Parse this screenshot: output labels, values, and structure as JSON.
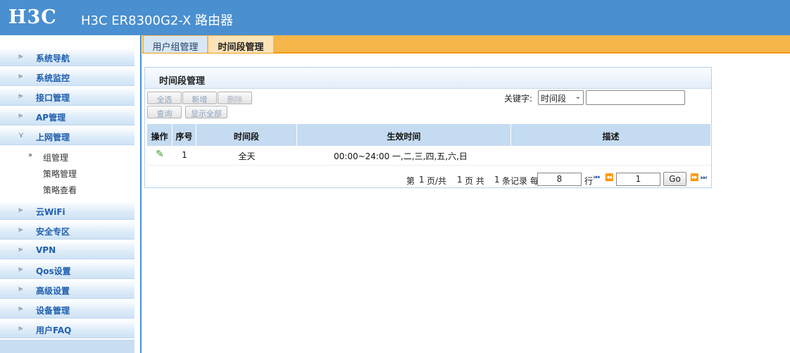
{
  "header": {
    "logo": "H3C",
    "title": "H3C ER8300G2-X 路由器"
  },
  "sidebar": {
    "items": [
      {
        "label": "系统导航",
        "arrow": "⪢"
      },
      {
        "label": "系统监控",
        "arrow": "⪢"
      },
      {
        "label": "接口管理",
        "arrow": "⪢"
      },
      {
        "label": "AP管理",
        "arrow": "⪢"
      },
      {
        "label": "上网管理",
        "arrow": "⋎"
      },
      {
        "label": "云WiFi",
        "arrow": "⪢"
      },
      {
        "label": "安全专区",
        "arrow": "⪢"
      },
      {
        "label": "VPN",
        "arrow": "⪢"
      },
      {
        "label": "Qos设置",
        "arrow": "⪢"
      },
      {
        "label": "高级设置",
        "arrow": "⪢"
      },
      {
        "label": "设备管理",
        "arrow": "⪢"
      },
      {
        "label": "用户FAQ",
        "arrow": "⪢"
      }
    ],
    "subitems": [
      {
        "label": "组管理",
        "arrow": "»"
      },
      {
        "label": "策略管理"
      },
      {
        "label": "策略查看"
      }
    ]
  },
  "tabs": [
    {
      "label": "用户组管理"
    },
    {
      "label": "时间段管理"
    }
  ],
  "panel": {
    "title": "时间段管理",
    "buttons": {
      "select_all": "全选",
      "add": "新增",
      "delete": "删除",
      "query": "查询",
      "show_all": "显示全部"
    },
    "keyword": {
      "label": "关键字:",
      "selected": "时间段",
      "chevron": "⌄",
      "value": ""
    }
  },
  "table": {
    "columns": [
      "操作",
      "序号",
      "时间段",
      "生效时间",
      "描述"
    ],
    "rows": [
      {
        "edit_icon": "✎",
        "index": "1",
        "period": "全天",
        "effective": "00:00~24:00 一,二,三,四,五,六,日",
        "desc": ""
      }
    ]
  },
  "pager": {
    "prefix": "第",
    "current_page": "1",
    "total_label": "页/共",
    "total_pages": "1",
    "records_label": "页 共",
    "records": "1",
    "per_page_label": "条记录 每页",
    "per_page": "8",
    "rows_label": "行",
    "first_icon": "⏮",
    "prev_icon": "⏪",
    "goto_value": "1",
    "go_label": "Go",
    "next_icon": "⏩",
    "last_icon": "⏭"
  },
  "colors": {
    "header_bg": "#4a8fd0",
    "tabbar_bg": "#f7b64b",
    "menu_text": "#1f5fae",
    "table_head": "#c5dbf1"
  }
}
